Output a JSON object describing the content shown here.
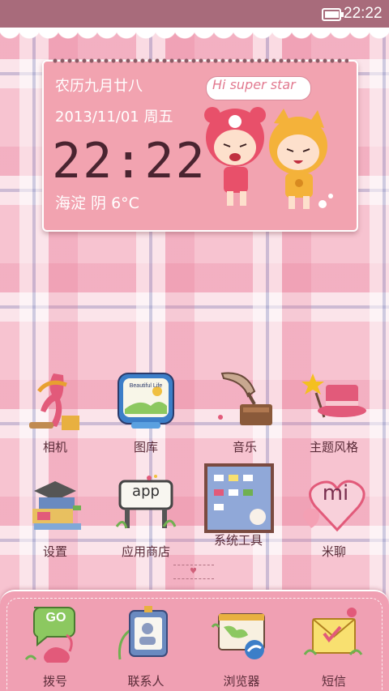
{
  "status_bar": {
    "time": "22:22",
    "battery_level": 0.85,
    "background": "#a86b7b"
  },
  "widget": {
    "lunar_date": "农历九月廿八",
    "date": "2013/11/01 周五",
    "time": "22:22",
    "weather": "海淀 阴 6°C",
    "speech_bubble": "Hi super star"
  },
  "apps": [
    {
      "label": "相机",
      "icon": "camera-icon"
    },
    {
      "label": "图库",
      "icon": "gallery-icon"
    },
    {
      "label": "音乐",
      "icon": "music-icon"
    },
    {
      "label": "主题风格",
      "icon": "themes-icon"
    },
    {
      "label": "设置",
      "icon": "settings-icon"
    },
    {
      "label": "应用商店",
      "icon": "app-store-icon"
    },
    {
      "label": "系统工具",
      "icon": "system-tools-icon"
    },
    {
      "label": "米聊",
      "icon": "miliao-icon"
    }
  ],
  "app_store_sign": "app",
  "miliao_badge": "mi",
  "gallery_card": "Beautiful Life",
  "dock": [
    {
      "label": "拨号",
      "icon": "phone-icon"
    },
    {
      "label": "联系人",
      "icon": "contacts-icon"
    },
    {
      "label": "浏览器",
      "icon": "browser-icon"
    },
    {
      "label": "短信",
      "icon": "messages-icon"
    }
  ],
  "dialer_badge": "GO",
  "colors": {
    "accent_pink": "#f2a3b0",
    "dock_pink": "#f0a0b3",
    "label_text": "#5a2b38"
  }
}
